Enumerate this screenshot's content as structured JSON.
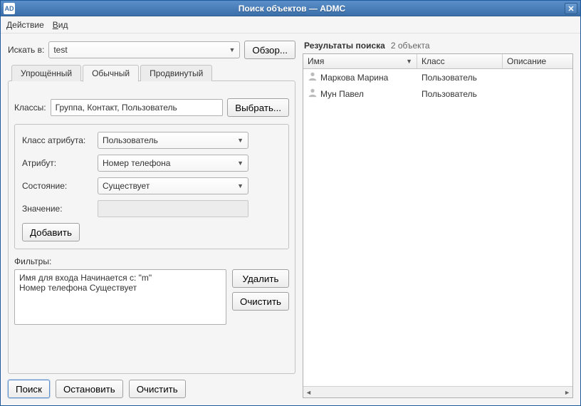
{
  "window": {
    "app_icon": "AD",
    "title": "Поиск объектов — ADMC"
  },
  "menu": {
    "action": "Действие",
    "view": "Вид"
  },
  "search_in": {
    "label": "Искать в:",
    "value": "test",
    "browse": "Обзор..."
  },
  "tabs": {
    "simple": "Упрощённый",
    "normal": "Обычный",
    "advanced": "Продвинутый"
  },
  "classes": {
    "label": "Классы:",
    "value": "Группа, Контакт, Пользователь",
    "select": "Выбрать..."
  },
  "attr": {
    "class_label": "Класс атрибута:",
    "class_value": "Пользователь",
    "attr_label": "Атрибут:",
    "attr_value": "Номер телефона",
    "state_label": "Состояние:",
    "state_value": "Существует",
    "value_label": "Значение:",
    "add": "Добавить"
  },
  "filters": {
    "label": "Фильтры:",
    "items": "Имя для входа Начинается с: \"m\"\nНомер телефона Существует",
    "remove": "Удалить",
    "clear": "Очистить"
  },
  "actions": {
    "search": "Поиск",
    "stop": "Остановить",
    "clear": "Очистить"
  },
  "results": {
    "heading": "Результаты поиска",
    "count": "2 объекта",
    "columns": {
      "name": "Имя",
      "class": "Класс",
      "desc": "Описание"
    },
    "rows": [
      {
        "name": "Маркова Марина",
        "class": "Пользователь"
      },
      {
        "name": "Мун Павел",
        "class": "Пользователь"
      }
    ]
  }
}
